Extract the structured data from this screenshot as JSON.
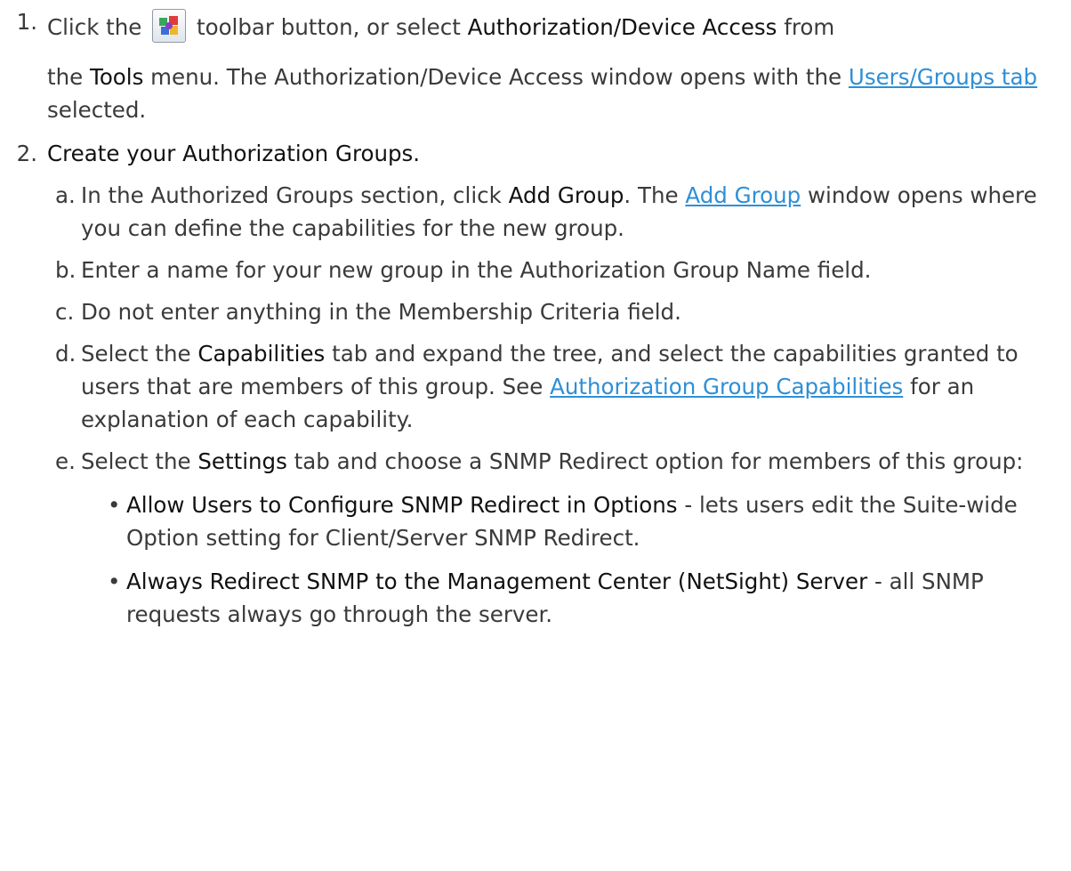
{
  "step1": {
    "number": "1.",
    "click_the": "Click the",
    "toolbar_text": "toolbar button, or select",
    "menu_item": "Authorization/Device Access",
    "from": "from",
    "the": "the",
    "tools_menu": "Tools",
    "menu_text": "menu. The Authorization/Device Access window opens with the",
    "link_users_groups": "Users/Groups tab",
    "selected": "selected.",
    "toolbar_icon": "authorization-device-access-icon"
  },
  "step2": {
    "number": "2.",
    "title": "Create your Authorization Groups.",
    "a": {
      "letter": "a.",
      "t1": "In the Authorized Groups section, click",
      "add_group_bold": "Add Group",
      "t2": ". The",
      "link_add_group": "Add Group",
      "t3": "window opens where you can define the capabilities for the new group."
    },
    "b": {
      "letter": "b.",
      "text": "Enter a name for your new group in the Authorization Group Name field."
    },
    "c": {
      "letter": "c.",
      "text": "Do not enter anything in the Membership Criteria field."
    },
    "d": {
      "letter": "d.",
      "t1": "Select the",
      "capabilities_bold": "Capabilities",
      "t2": "tab and expand the tree, and select the capabilities granted to users that are members of this group. See",
      "link_capabilities": "Authorization Group Capabilities",
      "t3": "for an explanation of each capability."
    },
    "e": {
      "letter": "e.",
      "t1": "Select the",
      "settings_bold": "Settings",
      "t2": "tab and choose a SNMP Redirect option for members of this group:",
      "bullets": [
        {
          "bold": "Allow Users to Configure SNMP Redirect in Options",
          "text": " - lets users edit the Suite-wide Option setting for Client/Server SNMP Redirect."
        },
        {
          "bold": "Always Redirect SNMP to the Management Center (NetSight) Server",
          "text": " - all SNMP requests always go through the server."
        }
      ]
    }
  },
  "colors": {
    "text": "#3a3a3a",
    "emphasis": "#111111",
    "link": "#2e8fd6"
  }
}
